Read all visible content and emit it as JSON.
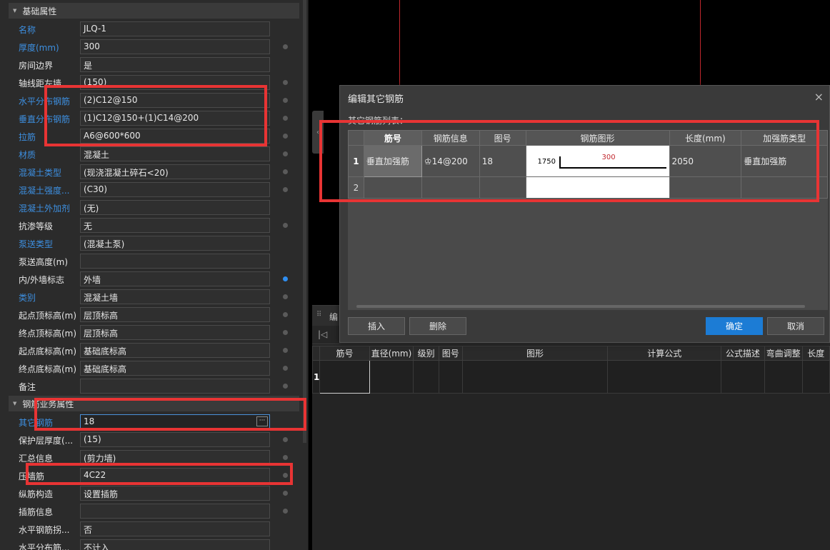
{
  "left_panel": {
    "section_basic": "基础属性",
    "section_rebar": "钢筋业务属性",
    "rows_basic": [
      {
        "label": "名称",
        "value": "JLQ-1",
        "link": true,
        "dot": ""
      },
      {
        "label": "厚度(mm)",
        "value": "300",
        "link": true,
        "dot": "gray"
      },
      {
        "label": "房间边界",
        "value": "是",
        "link": false,
        "dot": ""
      },
      {
        "label": "轴线距左墙...",
        "value": "(150)",
        "link": false,
        "dot": "gray"
      },
      {
        "label": "水平分布钢筋",
        "value": "(2)C12@150",
        "link": true,
        "dot": "gray"
      },
      {
        "label": "垂直分布钢筋",
        "value": "(1)C12@150+(1)C14@200",
        "link": true,
        "dot": "gray"
      },
      {
        "label": "拉筋",
        "value": "A6@600*600",
        "link": true,
        "dot": "gray"
      },
      {
        "label": "材质",
        "value": "混凝土",
        "link": true,
        "dot": "gray"
      },
      {
        "label": "混凝土类型",
        "value": "(现浇混凝土碎石<20)",
        "link": true,
        "dot": "gray"
      },
      {
        "label": "混凝土强度...",
        "value": "(C30)",
        "link": true,
        "dot": "gray"
      },
      {
        "label": "混凝土外加剂",
        "value": "(无)",
        "link": true,
        "dot": ""
      },
      {
        "label": "抗渗等级",
        "value": "无",
        "link": false,
        "dot": "gray"
      },
      {
        "label": "泵送类型",
        "value": "(混凝土泵)",
        "link": true,
        "dot": ""
      },
      {
        "label": "泵送高度(m)",
        "value": "",
        "link": false,
        "dot": ""
      },
      {
        "label": "内/外墙标志",
        "value": "外墙",
        "link": false,
        "dot": "blue"
      },
      {
        "label": "类别",
        "value": "混凝土墙",
        "link": true,
        "dot": "gray"
      },
      {
        "label": "起点顶标高(m)",
        "value": "层顶标高",
        "link": false,
        "dot": "gray"
      },
      {
        "label": "终点顶标高(m)",
        "value": "层顶标高",
        "link": false,
        "dot": "gray"
      },
      {
        "label": "起点底标高(m)",
        "value": "基础底标高",
        "link": false,
        "dot": "gray"
      },
      {
        "label": "终点底标高(m)",
        "value": "基础底标高",
        "link": false,
        "dot": "gray"
      },
      {
        "label": "备注",
        "value": "",
        "link": false,
        "dot": "gray"
      }
    ],
    "rows_rebar": [
      {
        "label": "其它钢筋",
        "value": "18",
        "link": true,
        "dot": "",
        "active": true
      },
      {
        "label": "保护层厚度(...",
        "value": "(15)",
        "link": false,
        "dot": "gray"
      },
      {
        "label": "汇总信息",
        "value": "(剪力墙)",
        "link": false,
        "dot": "gray"
      },
      {
        "label": "压墙筋",
        "value": "4C22",
        "link": false,
        "dot": "gray"
      },
      {
        "label": "纵筋构造",
        "value": "设置插筋",
        "link": false,
        "dot": "gray"
      },
      {
        "label": "插筋信息",
        "value": "",
        "link": false,
        "dot": "gray"
      },
      {
        "label": "水平钢筋拐...",
        "value": "否",
        "link": false,
        "dot": ""
      },
      {
        "label": "水平分布筋...",
        "value": "不计入",
        "link": false,
        "dot": ""
      }
    ],
    "more_button": "···"
  },
  "canvas": {
    "side_tab_arrow": "‹",
    "line_color": "#c1272d"
  },
  "dialog": {
    "title": "编辑其它钢筋",
    "close_icon": "×",
    "list_label": "其它钢筋列表：",
    "columns": [
      "筋号",
      "钢筋信息",
      "图号",
      "钢筋图形",
      "长度(mm)",
      "加强筋类型"
    ],
    "rows": [
      {
        "num": "1",
        "jinhao": "垂直加强筋",
        "info": "♔14@200",
        "tuhao": "18",
        "shape_left": "1750",
        "shape_top": "300",
        "length": "2050",
        "type": "垂直加强筋"
      },
      {
        "num": "2",
        "jinhao": "",
        "info": "",
        "tuhao": "",
        "length": "",
        "type": ""
      }
    ],
    "buttons": {
      "insert": "插入",
      "delete": "删除",
      "ok": "确定",
      "cancel": "取消"
    },
    "accent": "#1c7cd5"
  },
  "bottom_panel": {
    "tab_label": "编",
    "grip": "⠿",
    "first_icon": "|◁",
    "columns": [
      "筋号",
      "直径(mm)",
      "级别",
      "图号",
      "图形",
      "计算公式",
      "公式描述",
      "弯曲调整",
      "长度"
    ],
    "row_num": "1"
  },
  "annotation_color": "#e83434"
}
